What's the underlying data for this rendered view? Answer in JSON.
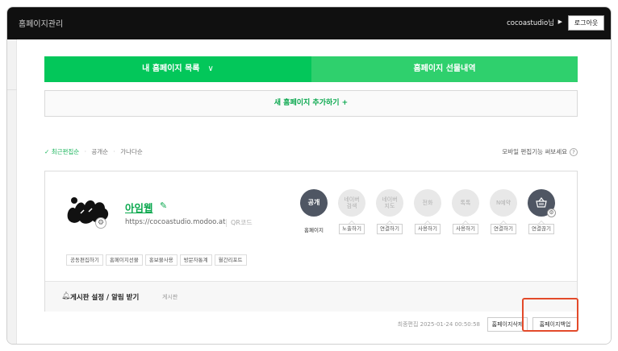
{
  "topbar": {
    "title": "홈페이지관리",
    "user": "cocoastudio님",
    "logout": "로그아웃"
  },
  "tabs": {
    "my_sites": "내 홈페이지 목록",
    "gift_history": "홈페이지 선물내역"
  },
  "add_site": "새 홈페이지 추가하기 +",
  "sort": {
    "check": "✓",
    "recent": "최근편집순",
    "public": "공개순",
    "alphabet": "가나다순",
    "mobile_edit": "모바일 편집기능 써보세요",
    "help": "?"
  },
  "site": {
    "name": "아임웹",
    "url": "https://cocoastudio.modoo.at",
    "qr": "QR코드",
    "tags": [
      "공동편집하기",
      "홈페이지선물",
      "홍보물사용",
      "방문자통계",
      "월간리포트"
    ],
    "services": [
      {
        "icon": "공개",
        "active": true,
        "label": "홈페이지"
      },
      {
        "icon": "네이버\n검색",
        "active": false,
        "pill": "노출하기"
      },
      {
        "icon": "네이버\n지도",
        "active": false,
        "pill": "연결하기"
      },
      {
        "icon": "전화",
        "active": false,
        "pill": "사용하기"
      },
      {
        "icon": "톡톡",
        "active": false,
        "pill": "사용하기"
      },
      {
        "icon": "N예약",
        "active": false,
        "pill": "연결하기"
      },
      {
        "icon": "cart-icon",
        "active": true,
        "pill": "연결끊기"
      }
    ],
    "board_setting": "게시판 설정 / 알림 받기",
    "board_label": "게시판"
  },
  "footer": {
    "last_edited": "최종편집 2025-01-24 00:50:58",
    "delete": "홈페이지삭제",
    "backup": "홈페이지백업"
  },
  "colors": {
    "accent": "#03c75a",
    "highlight": "#e34a2a"
  }
}
